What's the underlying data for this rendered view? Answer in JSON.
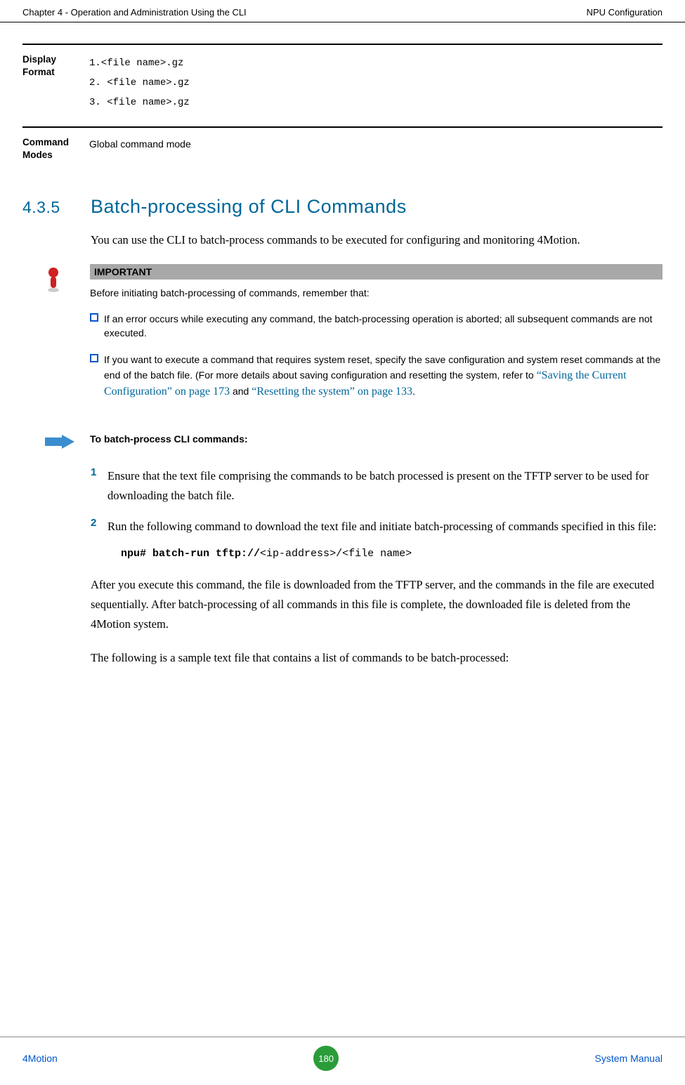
{
  "header": {
    "left": "Chapter 4 - Operation and Administration Using the CLI",
    "right": "NPU Configuration"
  },
  "rows": {
    "displayFormat": {
      "label": "Display Format",
      "lines": [
        "1.<file name>.gz",
        "2. <file name>.gz",
        "3. <file name>.gz"
      ]
    },
    "commandModes": {
      "label": "Command Modes",
      "text": "Global command mode"
    }
  },
  "section": {
    "number": "4.3.5",
    "title": "Batch-processing of CLI Commands"
  },
  "intro": "You can use the CLI to batch-process commands to be executed for configuring and monitoring 4Motion.",
  "important": {
    "heading": "IMPORTANT",
    "preface": "Before initiating batch-processing of commands, remember that:",
    "bullet1": "If an error occurs while executing any command, the batch-processing operation is aborted; all subsequent commands are not executed.",
    "bullet2_a": "If you want to execute a command that requires system reset, specify the save configuration and system reset commands at the end of the batch file. (For more details about saving configuration and resetting the system, refer to ",
    "bullet2_link1": "“Saving the Current Configuration” on page 173",
    "bullet2_mid": " and ",
    "bullet2_link2": "“Resetting the system” on page 133",
    "bullet2_end": "."
  },
  "procHeading": "To batch-process CLI commands:",
  "steps": {
    "s1": {
      "num": "1",
      "text": "Ensure that the text file comprising the commands to be batch processed is present on the TFTP server to be used for downloading the batch file."
    },
    "s2": {
      "num": "2",
      "text": "Run the following command to download the text file and initiate batch-processing of commands specified in this file:"
    }
  },
  "command": {
    "bold": "npu# batch-run tftp://",
    "plain": "<ip-address>/<file name>"
  },
  "para1": "After you execute this command, the file is downloaded from the TFTP server, and the commands in the file are executed sequentially. After batch-processing of all commands in this file is complete, the downloaded file is deleted from the 4Motion system.",
  "para2": "The following is a sample text file that contains a list of commands to be batch-processed:",
  "footer": {
    "left": "4Motion",
    "page": "180",
    "right": "System Manual"
  }
}
